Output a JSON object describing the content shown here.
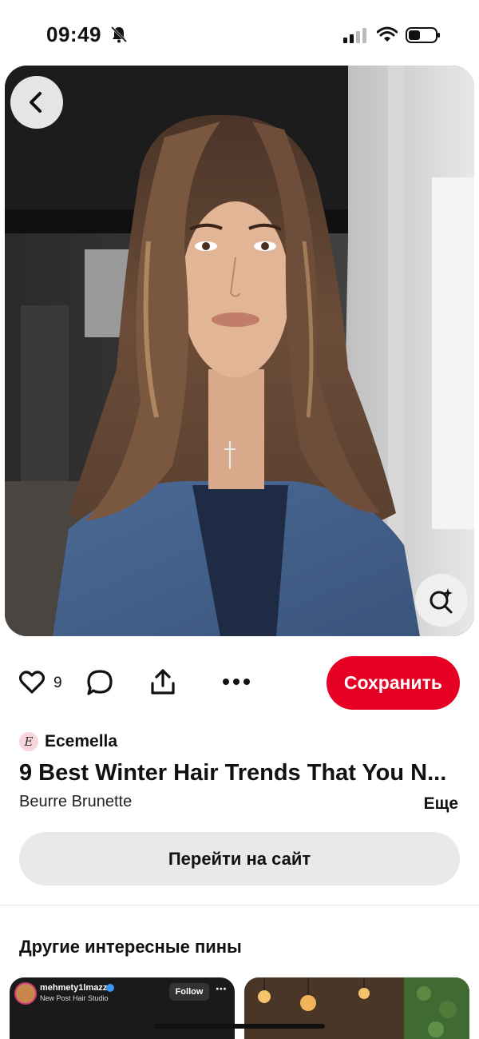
{
  "status_bar": {
    "time": "09:49",
    "icons": [
      "bell-slash-icon",
      "signal-icon",
      "wifi-icon",
      "battery-icon"
    ]
  },
  "pin": {
    "image_description_icon": "photo",
    "like_count": "9",
    "save_label": "Сохранить",
    "author": {
      "name": "Ecemella",
      "avatar_letter": "E"
    },
    "title": "9 Best Winter Hair Trends That You N...",
    "subtitle": "Beurre Brunette",
    "more_label": "Еще",
    "visit_label": "Перейти на сайт"
  },
  "related": {
    "title": "Другие интересные пины",
    "pins": [
      {
        "user": "mehmety1lmazz",
        "sub": "New Post Hair Studio",
        "follow_label": "Follow"
      }
    ]
  },
  "colors": {
    "accent": "#e60023",
    "button_gray": "#e9e9e9"
  }
}
